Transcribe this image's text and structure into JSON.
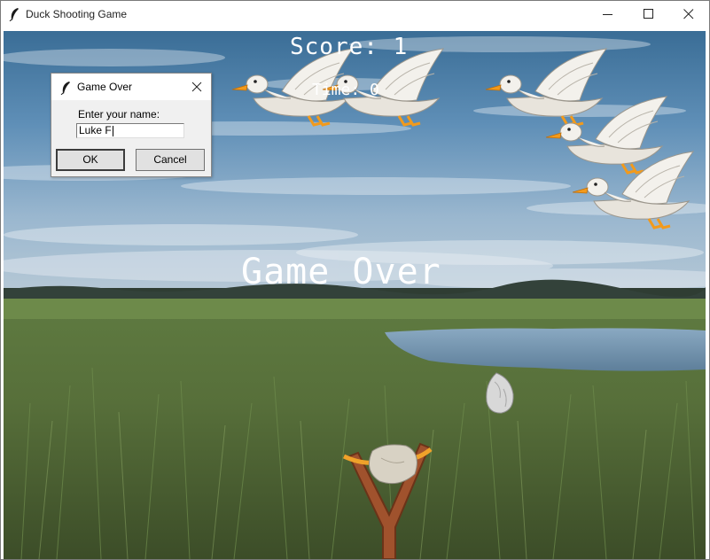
{
  "window": {
    "title": "Duck Shooting Game"
  },
  "game": {
    "score_text": "Score: 1",
    "time_text": "Time: 0",
    "game_over_text": "Game Over"
  },
  "dialog": {
    "title": "Game Over",
    "prompt": "Enter your name:",
    "name_value": "Luke F",
    "ok_label": "OK",
    "cancel_label": "Cancel"
  },
  "icons": {
    "app": "feather-icon",
    "minimize": "minimize-icon",
    "maximize": "maximize-icon",
    "close": "close-icon"
  },
  "colors": {
    "sky_top": "#3c6f97",
    "sky_mid": "#9fbbd2",
    "grass": "#4f6a34",
    "water": "#6e90ad",
    "text": "#ffffff",
    "beak": "#f29a1c"
  }
}
